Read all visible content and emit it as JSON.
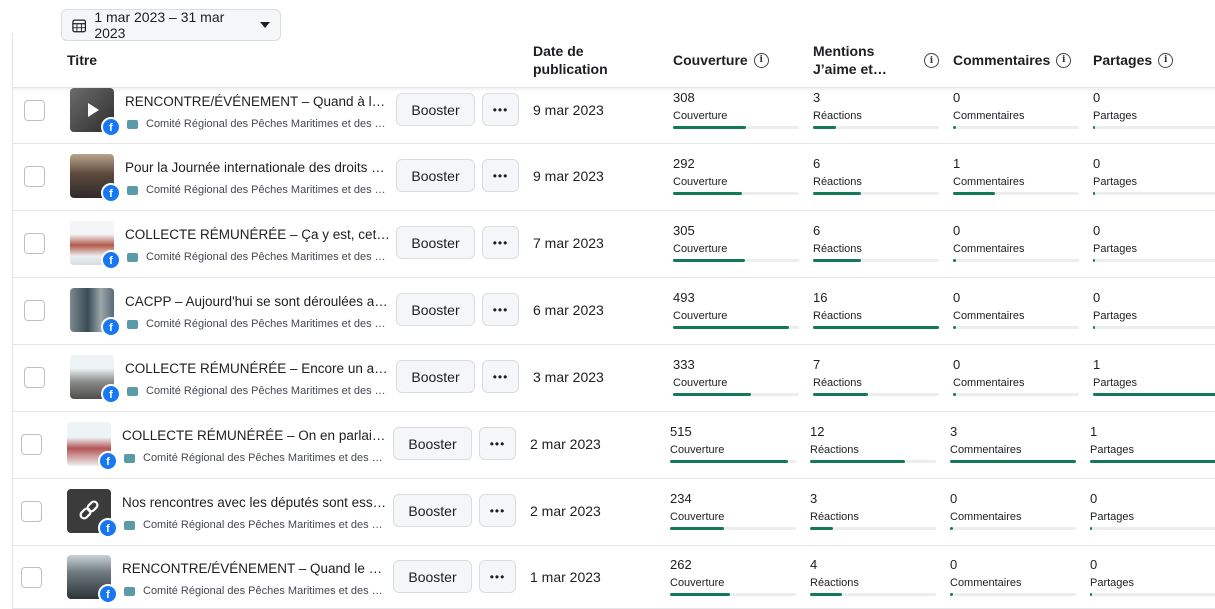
{
  "date_range": "1 mar 2023 – 31 mar 2023",
  "icons": {
    "calendar": "calendar-icon",
    "caret": "caret-down-icon",
    "info": "info-icon",
    "facebook": "facebook-icon",
    "page": "page-icon",
    "more": "more-icon"
  },
  "colors": {
    "metric_bar": "#137a55",
    "facebook": "#1877f2"
  },
  "header": {
    "titre": "Titre",
    "date_l1": "Date de",
    "date_l2": "publication",
    "couverture": "Couverture",
    "mentions_l1": "Mentions",
    "mentions_l2": "J’aime et…",
    "commentaires": "Commentaires",
    "partages": "Partages",
    "info_glyph": "i"
  },
  "labels": {
    "booster": "Booster",
    "more": "•••",
    "couverture": "Couverture",
    "reactions": "Réactions",
    "commentaires": "Commentaires",
    "partages": "Partages",
    "fb": "f"
  },
  "posts": [
    {
      "title": "RENCONTRE/ÉVÉNEMENT – Quand à la célé...",
      "page": "Comité Régional des Pêches Maritimes et des El...",
      "date": "9 mar 2023",
      "couverture": "308",
      "reactions": "3",
      "commentaires": "0",
      "partages": "0",
      "fills": [
        0.58,
        0.18,
        0.02,
        0.0
      ]
    },
    {
      "title": "Pour la Journée internationale des droits des...",
      "page": "Comité Régional des Pêches Maritimes et des El...",
      "date": "9 mar 2023",
      "couverture": "292",
      "reactions": "6",
      "commentaires": "1",
      "partages": "0",
      "fills": [
        0.55,
        0.38,
        0.33,
        0.0
      ]
    },
    {
      "title": "COLLECTE RÉMUNÉRÉE – Ça y est, cette fois-...",
      "page": "Comité Régional des Pêches Maritimes et des El...",
      "date": "7 mar 2023",
      "couverture": "305",
      "reactions": "6",
      "commentaires": "0",
      "partages": "0",
      "fills": [
        0.57,
        0.38,
        0.02,
        0.0
      ]
    },
    {
      "title": "CACPP – Aujourd'hui se sont déroulées au C...",
      "page": "Comité Régional des Pêches Maritimes et des El...",
      "date": "6 mar 2023",
      "couverture": "493",
      "reactions": "16",
      "commentaires": "0",
      "partages": "0",
      "fills": [
        0.92,
        1.0,
        0.02,
        0.0
      ]
    },
    {
      "title": "COLLECTE RÉMUNÉRÉE – Encore un autre po...",
      "page": "Comité Régional des Pêches Maritimes et des El...",
      "date": "3 mar 2023",
      "couverture": "333",
      "reactions": "7",
      "commentaires": "0",
      "partages": "1",
      "fills": [
        0.62,
        0.44,
        0.02,
        1.0
      ]
    },
    {
      "title": "COLLECTE RÉMUNÉRÉE – On en parlait hier......",
      "page": "Comité Régional des Pêches Maritimes et des El...",
      "date": "2 mar 2023",
      "couverture": "515",
      "reactions": "12",
      "commentaires": "3",
      "partages": "1",
      "fills": [
        0.94,
        0.75,
        1.0,
        1.0
      ]
    },
    {
      "title": "Nos rencontres avec les députés sont essent...",
      "page": "Comité Régional des Pêches Maritimes et des El...",
      "date": "2 mar 2023",
      "couverture": "234",
      "reactions": "3",
      "commentaires": "0",
      "partages": "0",
      "fills": [
        0.43,
        0.18,
        0.02,
        0.0
      ]
    },
    {
      "title": "RENCONTRE/ÉVÉNEMENT – Quand le présid...",
      "page": "Comité Régional des Pêches Maritimes et des El...",
      "date": "1 mar 2023",
      "couverture": "262",
      "reactions": "4",
      "commentaires": "0",
      "partages": "0",
      "fills": [
        0.48,
        0.25,
        0.02,
        0.0
      ]
    }
  ]
}
